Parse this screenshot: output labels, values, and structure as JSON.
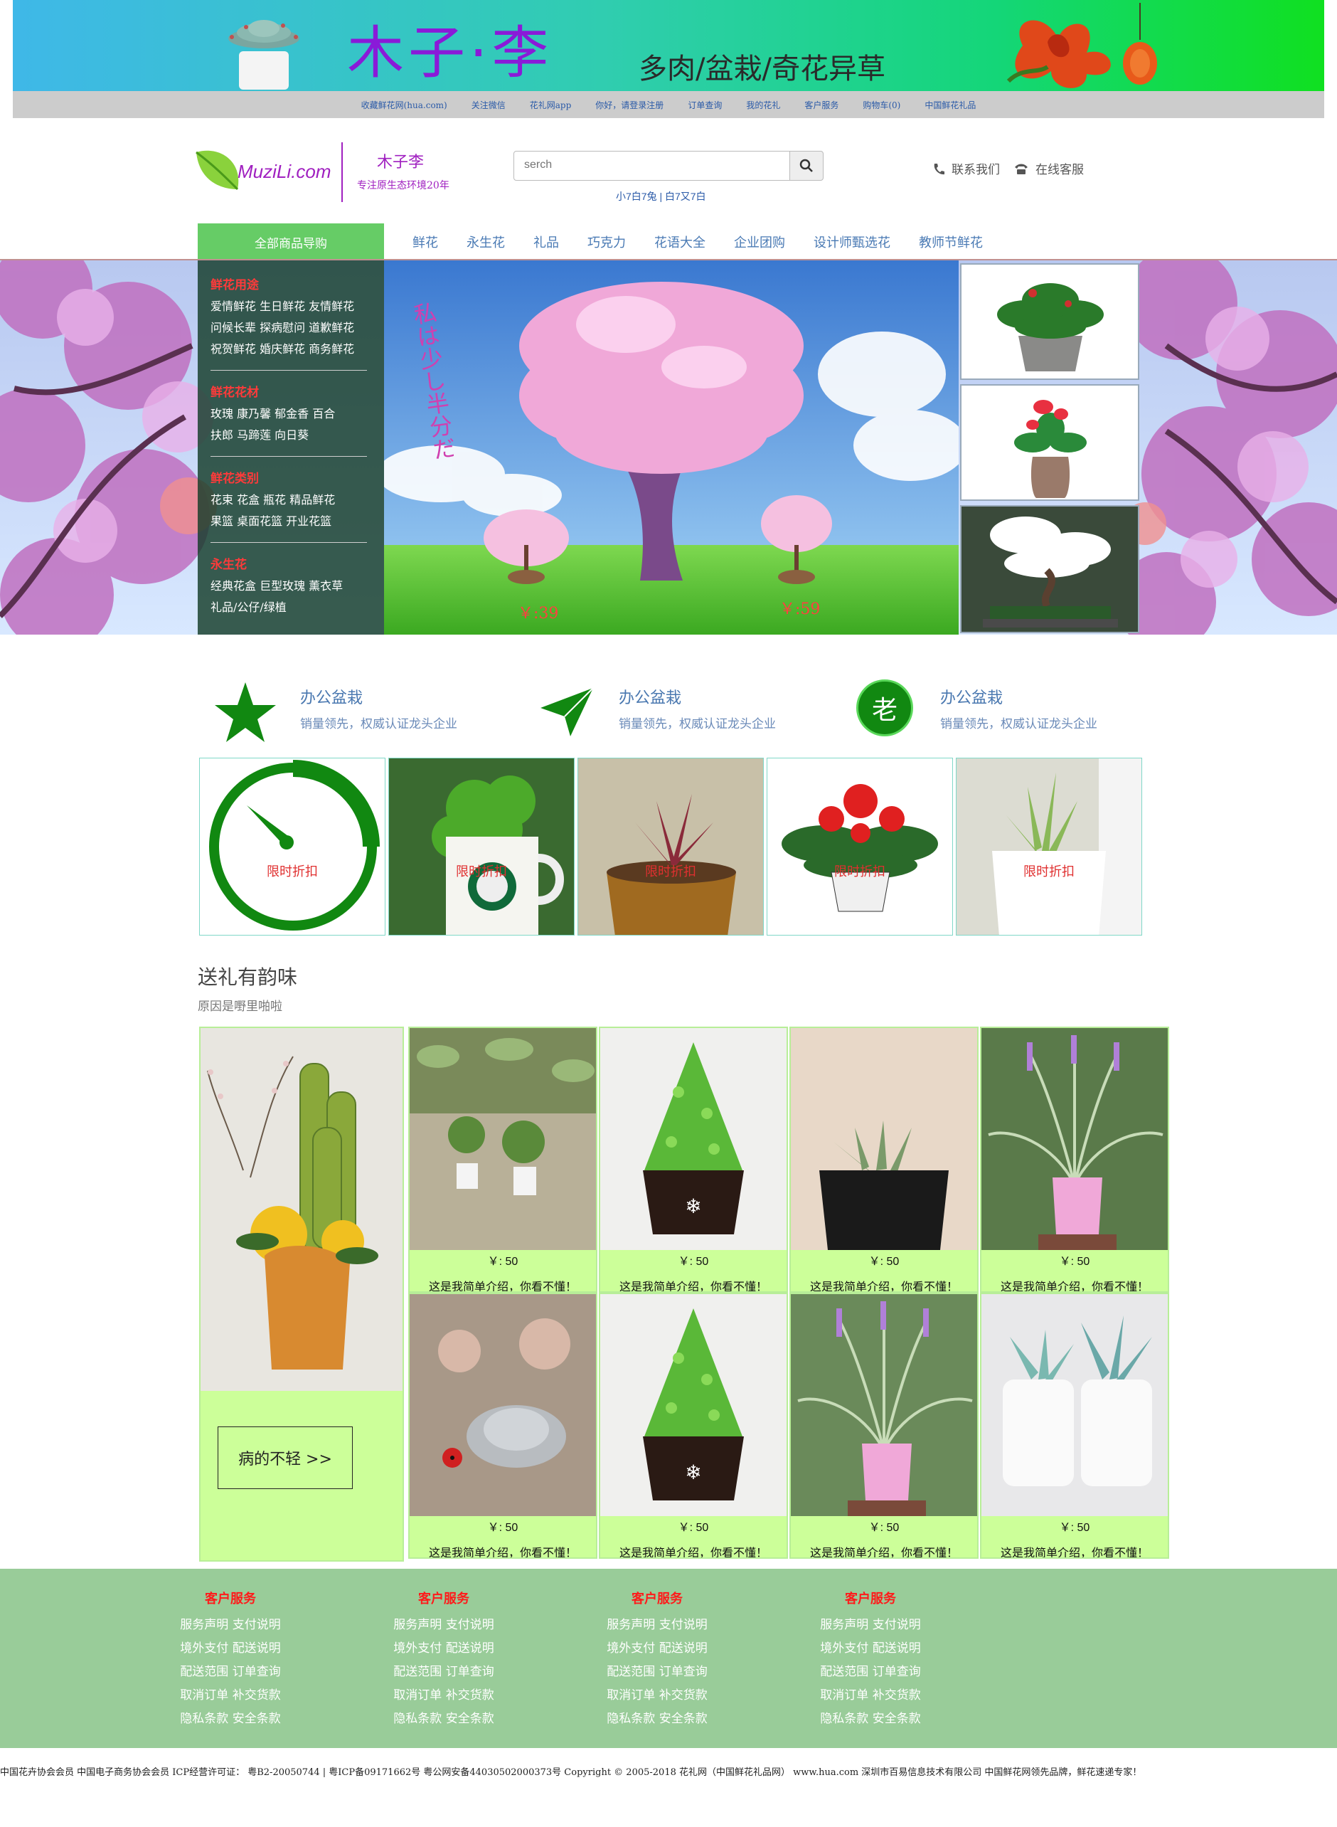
{
  "banner": {
    "title": "木子·李",
    "subtitle": "多肉/盆栽/奇花异草"
  },
  "top_links": [
    "收藏鲜花网(hua.com)",
    "关注微信",
    "花礼网app",
    "你好，请登录注册",
    "订单查询",
    "我的花礼",
    "客户服务",
    "购物车(0)",
    "中国鲜花礼品"
  ],
  "header": {
    "logo": "MuziLi.com",
    "brand": "木子李",
    "tagline": "专注原生态环境20年",
    "search_placeholder": "serch",
    "search_hint": "小7白7兔 | 白7又7白",
    "contact": "联系我们",
    "service": "在线客服"
  },
  "nav": {
    "category_label": "全部商品导购",
    "items": [
      "鲜花",
      "永生花",
      "礼品",
      "巧克力",
      "花语大全",
      "企业团购",
      "设计师甄选花",
      "教师节鲜花"
    ]
  },
  "sidebar": [
    {
      "heading": "鲜花用途",
      "lines": [
        "爱情鲜花 生日鲜花 友情鲜花",
        "问候长辈 探病慰问 道歉鲜花",
        "祝贺鲜花 婚庆鲜花 商务鲜花"
      ]
    },
    {
      "heading": "鲜花花材",
      "lines": [
        "玫瑰 康乃馨 郁金香 百合",
        "扶郎 马蹄莲 向日葵"
      ]
    },
    {
      "heading": "鲜花类别",
      "lines": [
        "花束 花盒 瓶花 精品鲜花",
        "果篮 桌面花篮 开业花篮"
      ]
    },
    {
      "heading": "永生花",
      "lines": [
        "经典花盒 巨型玫瑰 薰衣草",
        "礼品/公仔/绿植"
      ]
    }
  ],
  "hero": {
    "vertical_text": "私は少し半分だ",
    "price_left": "￥:39",
    "price_right": "￥:59"
  },
  "features": [
    {
      "icon": "star-icon",
      "title": "办公盆栽",
      "desc": "销量领先，权威认证龙头企业"
    },
    {
      "icon": "send-icon",
      "title": "办公盆栽",
      "desc": "销量领先，权威认证龙头企业"
    },
    {
      "icon": "laurel-badge-icon",
      "badge": "老",
      "title": "办公盆栽",
      "desc": "销量领先，权威认证龙头企业"
    }
  ],
  "tiles": [
    "限时折扣",
    "限时折扣",
    "限时折扣",
    "限时折扣",
    "限时折扣"
  ],
  "gift": {
    "title": "送礼有韵味",
    "subtitle": "原因是嘢里啪啦",
    "button": "病的不轻 >>"
  },
  "products": [
    {
      "price": "￥: 50",
      "desc": "这是我简单介绍，你看不懂！"
    },
    {
      "price": "￥: 50",
      "desc": "这是我简单介绍，你看不懂！"
    },
    {
      "price": "￥: 50",
      "desc": "这是我简单介绍，你看不懂！"
    },
    {
      "price": "￥: 50",
      "desc": "这是我简单介绍，你看不懂！"
    },
    {
      "price": "￥: 50",
      "desc": "这是我简单介绍，你看不懂！"
    },
    {
      "price": "￥: 50",
      "desc": "这是我简单介绍，你看不懂！"
    },
    {
      "price": "￥: 50",
      "desc": "这是我简单介绍，你看不懂！"
    },
    {
      "price": "￥: 50",
      "desc": "这是我简单介绍，你看不懂！"
    }
  ],
  "footer_columns": [
    {
      "heading": "客户服务",
      "links": [
        "服务声明 支付说明",
        "境外支付 配送说明",
        "配送范围 订单查询",
        "取消订单 补交货款",
        "隐私条款 安全条款"
      ]
    },
    {
      "heading": "客户服务",
      "links": [
        "服务声明 支付说明",
        "境外支付 配送说明",
        "配送范围 订单查询",
        "取消订单 补交货款",
        "隐私条款 安全条款"
      ]
    },
    {
      "heading": "客户服务",
      "links": [
        "服务声明 支付说明",
        "境外支付 配送说明",
        "配送范围 订单查询",
        "取消订单 补交货款",
        "隐私条款 安全条款"
      ]
    },
    {
      "heading": "客户服务",
      "links": [
        "服务声明 支付说明",
        "境外支付 配送说明",
        "配送范围 订单查询",
        "取消订单 补交货款",
        "隐私条款 安全条款"
      ]
    }
  ],
  "copyright": "中国花卉协会会员 中国电子商务协会会员 ICP经营许可证： 粤B2-20050744 | 粤ICP备09171662号 粤公网安备44030502000373号 Copyright © 2005-2018 花礼网（中国鲜花礼品网） www.hua.com 深圳市百易信息技术有限公司 中国鲜花网领先品牌，鲜花速递专家！",
  "colors": {
    "accent_green": "#66cc66",
    "footer_green": "#99cc99",
    "price_red": "#ff4040",
    "link_blue": "#4a7ab4",
    "card_bg": "#ccff99"
  }
}
